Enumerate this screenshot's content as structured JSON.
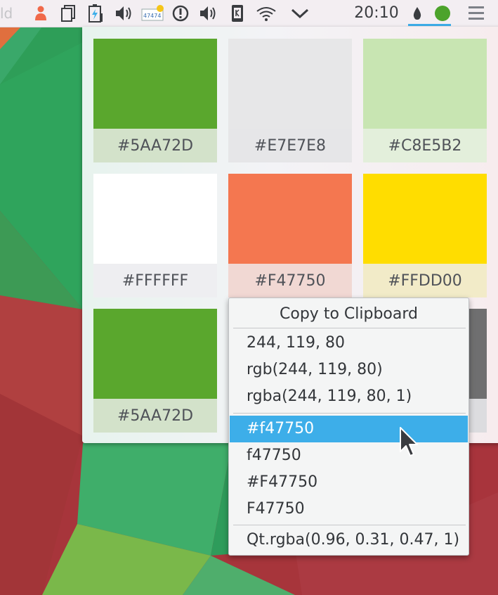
{
  "panel": {
    "left_text": "ld",
    "tray_icons": [
      {
        "name": "user-switcher-icon"
      },
      {
        "name": "clipboard-icon"
      },
      {
        "name": "battery-icon"
      },
      {
        "name": "volume-icon"
      },
      {
        "name": "weather-icon",
        "text": "47474"
      },
      {
        "name": "notifications-icon"
      },
      {
        "name": "volume-icon-2"
      },
      {
        "name": "kde-connect-icon"
      },
      {
        "name": "wifi-icon"
      },
      {
        "name": "expand-tray-icon"
      }
    ],
    "clock": "20:10",
    "accent": "#3daee9"
  },
  "palette": {
    "swatches": [
      {
        "hex": "#5AA72D",
        "color": "#5AA72D",
        "label_bg": "#d3e2ca"
      },
      {
        "hex": "#E7E7E8",
        "color": "#E7E7E8",
        "label_bg": "#e6e6e8"
      },
      {
        "hex": "#C8E5B2",
        "color": "#C8E5B2",
        "label_bg": "#e3efdb"
      },
      {
        "hex": "#FFFFFF",
        "color": "#FFFFFF",
        "label_bg": "#eeeef1"
      },
      {
        "hex": "#F47750",
        "color": "#F47750",
        "label_bg": "#f1d8d3"
      },
      {
        "hex": "#FFDD00",
        "color": "#FFDD00",
        "label_bg": "#f2ebc8"
      },
      {
        "hex": "#5AA72D",
        "color": "#5AA72D",
        "label_bg": "#d3e2ca"
      }
    ]
  },
  "context_menu": {
    "title": "Copy to Clipboard",
    "items": [
      "244, 119, 80",
      "rgb(244, 119, 80)",
      "rgba(244, 119, 80, 1)",
      "#f47750",
      "f47750",
      "#F47750",
      "F47750",
      "Qt.rgba(0.96, 0.31, 0.47, 1)"
    ],
    "highlighted": "#f47750"
  }
}
